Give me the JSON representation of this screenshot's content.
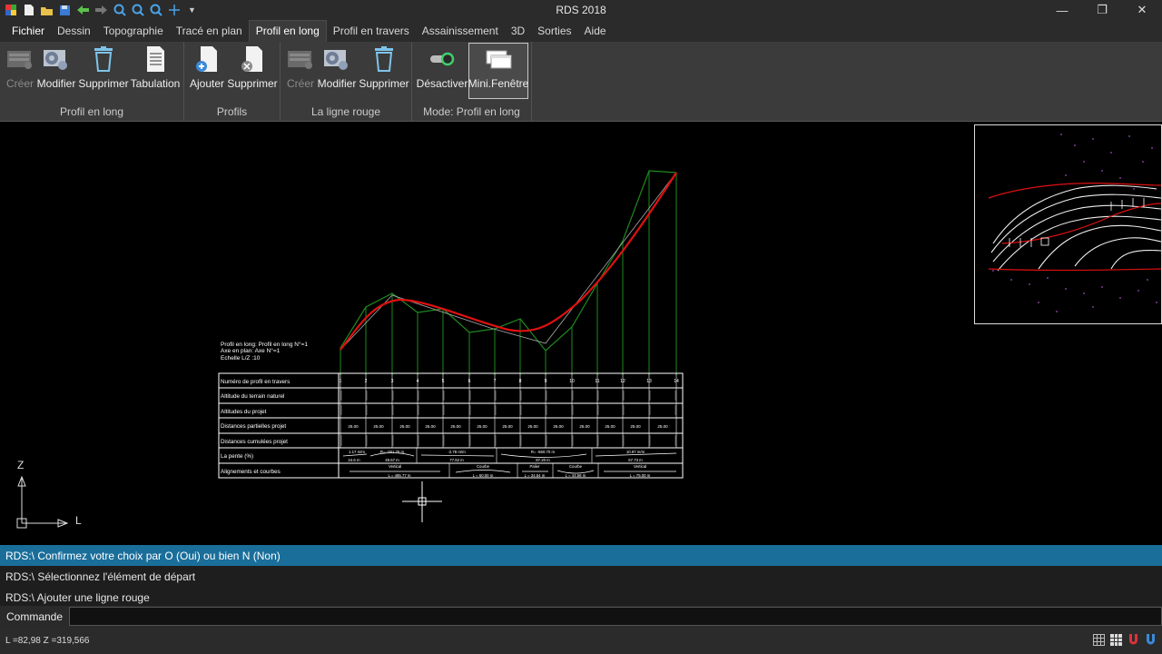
{
  "window": {
    "title": "RDS 2018",
    "minimize": "—",
    "restore": "❐",
    "close": "✕"
  },
  "menu": [
    {
      "label": "Fichier"
    },
    {
      "label": "Dessin"
    },
    {
      "label": "Topographie"
    },
    {
      "label": "Tracé en plan"
    },
    {
      "label": "Profil en long"
    },
    {
      "label": "Profil en travers"
    },
    {
      "label": "Assainissement"
    },
    {
      "label": "3D"
    },
    {
      "label": "Sorties"
    },
    {
      "label": "Aide"
    }
  ],
  "ribbon": {
    "groups": [
      {
        "label": "Profil en long",
        "buttons": [
          "Créer",
          "Modifier",
          "Supprimer",
          "Tabulation"
        ]
      },
      {
        "label": "Profils",
        "buttons": [
          "Ajouter",
          "Supprimer"
        ]
      },
      {
        "label": "La ligne rouge",
        "buttons": [
          "Créer",
          "Modifier",
          "Supprimer"
        ]
      },
      {
        "label": "Mode: Profil en long",
        "buttons": [
          "Désactiver",
          "Mini.Fenêtre"
        ]
      }
    ]
  },
  "drawing": {
    "info_lines": [
      "Profil en long: Profil en long N°=1",
      "Axe en plan: Axe N°=1",
      "Echelle L/Z :10"
    ],
    "table_rows": [
      "Numéro de profil en travers",
      "Altitude du terrain naturel",
      "Altitudes du projet",
      "Distances partielles projet",
      "Distances cumulées projet",
      "La pente (%)",
      "Alignements et courbes"
    ],
    "profile_numbers": [
      "1",
      "2",
      "3",
      "4",
      "5",
      "6",
      "7",
      "8",
      "9",
      "10",
      "11",
      "12",
      "13",
      "14"
    ],
    "partial_distance": "25.00",
    "slope_labels": [
      "1.17 m/m",
      "R= -281.76 m",
      "-2.78 m/m",
      "R= -560.70 m",
      "10.97 m/m"
    ],
    "slope_lengths": [
      "24.6 m",
      "49.67 m",
      "77.62 m",
      "87.20 m",
      "67.73 m"
    ],
    "alignment_labels": [
      "Vertical",
      "Courbe",
      "Palier",
      "Courbe",
      "Vertical"
    ],
    "alignment_lengths": [
      "L = 485.77 m",
      "L = 60.00 m",
      "L = 34.54 m",
      "L = 44.58 m",
      "L = 75.00 m"
    ],
    "axis_z": "Z",
    "axis_l": "L"
  },
  "commands": {
    "history": [
      "RDS:\\ Confirmez votre choix par O (Oui) ou bien N (Non)",
      "RDS:\\ Sélectionnez l'élément de départ",
      "RDS:\\ Ajouter une ligne rouge"
    ],
    "prompt_label": "Commande"
  },
  "status": {
    "coords": "L =82,98   Z =319,566"
  },
  "colors": {
    "ribbon_bg": "#3b3b3b",
    "current_command": "#1a6e9a",
    "terrain_line": "#1f8a1f",
    "red_line": "#e01010"
  }
}
